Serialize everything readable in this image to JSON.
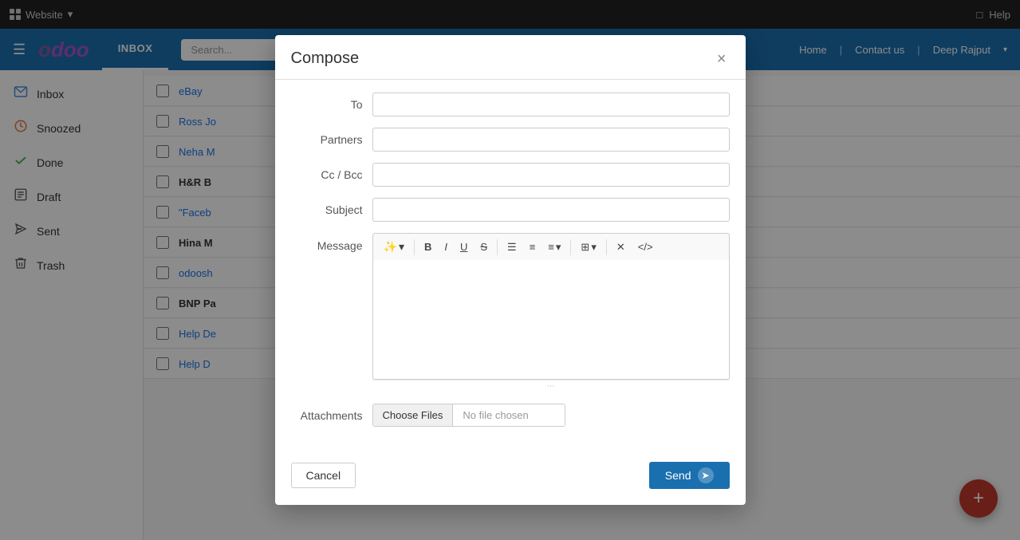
{
  "topbar": {
    "app_name": "Website",
    "help_label": "Help",
    "monitor_icon": "monitor-icon"
  },
  "header": {
    "logo": "odoo",
    "inbox_label": "INBOX",
    "search_placeholder": "Search...",
    "nav_home": "Home",
    "nav_contact": "Contact us",
    "user_name": "Deep Rajput"
  },
  "sidebar": {
    "items": [
      {
        "id": "inbox",
        "label": "Inbox",
        "icon": "📥",
        "class": "inbox"
      },
      {
        "id": "snoozed",
        "label": "Snoozed",
        "icon": "🕐",
        "class": "snoozed"
      },
      {
        "id": "done",
        "label": "Done",
        "icon": "✓",
        "class": "done"
      },
      {
        "id": "draft",
        "label": "Draft",
        "icon": "📋",
        "class": "draft"
      },
      {
        "id": "sent",
        "label": "Sent",
        "icon": "▶",
        "class": "sent"
      },
      {
        "id": "trash",
        "label": "Trash",
        "icon": "🗑",
        "class": "trash"
      }
    ]
  },
  "email_list": {
    "rows": [
      {
        "sender": "eBay",
        "bold": false
      },
      {
        "sender": "Ross Jo",
        "bold": false
      },
      {
        "sender": "Neha M",
        "bold": false
      },
      {
        "sender": "H&R B",
        "bold": true
      },
      {
        "sender": "\"Faceb",
        "bold": false
      },
      {
        "sender": "Hina M",
        "bold": true
      },
      {
        "sender": "odoosh",
        "bold": false
      },
      {
        "sender": "BNP Pa",
        "bold": true
      },
      {
        "sender": "Help De",
        "bold": false
      },
      {
        "sender": "Help D",
        "bold": false
      }
    ]
  },
  "dialog": {
    "title": "Compose",
    "close_label": "×",
    "fields": {
      "to_label": "To",
      "partners_label": "Partners",
      "cc_bcc_label": "Cc / Bcc",
      "subject_label": "Subject",
      "message_label": "Message",
      "attachments_label": "Attachments"
    },
    "toolbar": {
      "magic_label": "✨",
      "bold_label": "B",
      "italic_label": "I",
      "underline_label": "U",
      "strikethrough_label": "S̶",
      "unordered_list_label": "≡",
      "ordered_list_label": "≡",
      "align_label": "≡",
      "table_label": "⊞",
      "clear_label": "✕",
      "code_label": "</>",
      "align_arrow": "▾",
      "table_arrow": "▾"
    },
    "attachments": {
      "choose_files_label": "Choose Files",
      "no_file_label": "No file chosen"
    },
    "footer": {
      "cancel_label": "Cancel",
      "send_label": "Send"
    }
  },
  "fab": {
    "icon": "+"
  }
}
